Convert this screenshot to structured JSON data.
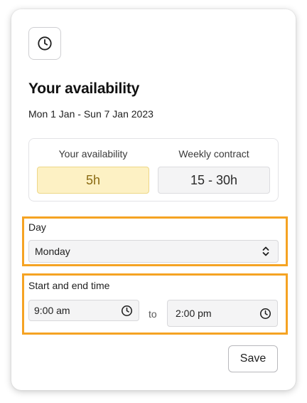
{
  "header": {
    "icon": "clock-icon",
    "title": "Your availability",
    "date_range": "Mon 1 Jan - Sun 7 Jan 2023"
  },
  "summary": {
    "availability_label": "Your availability",
    "availability_value": "5h",
    "contract_label": "Weekly contract",
    "contract_value": "15 - 30h"
  },
  "day": {
    "label": "Day",
    "selected": "Monday",
    "icon": "chevron-up-down-icon"
  },
  "time": {
    "label": "Start and end time",
    "start": "9:00 am",
    "separator": "to",
    "end": "2:00 pm",
    "icon": "clock-icon"
  },
  "actions": {
    "save_label": "Save"
  },
  "colors": {
    "highlight_bg": "#fdf1c4",
    "highlight_text": "#8a6a12",
    "focus_outline": "#f5a323"
  }
}
